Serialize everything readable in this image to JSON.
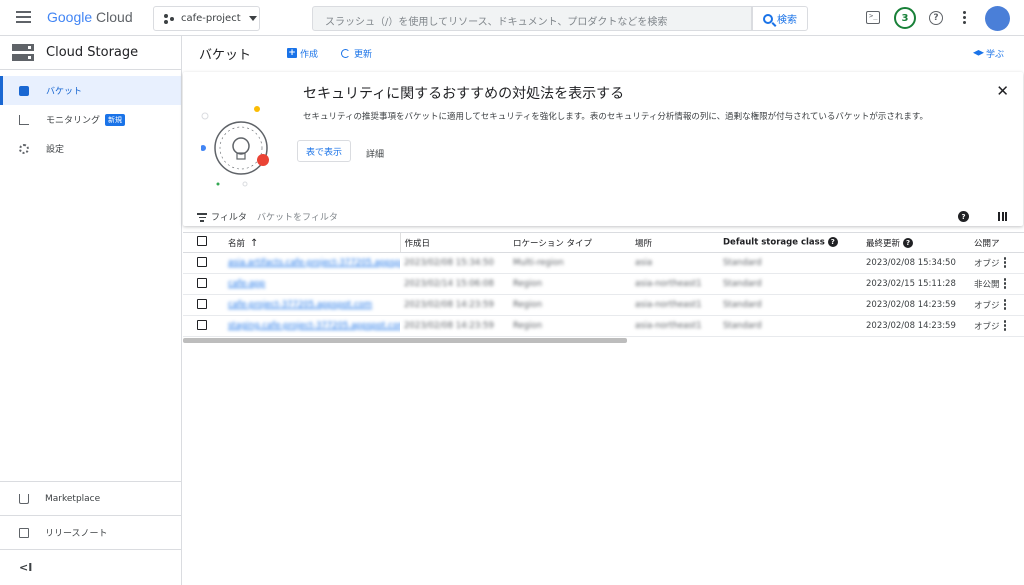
{
  "topbar": {
    "logo_google": "Google",
    "logo_cloud": "Cloud",
    "project": "cafe-project",
    "search_placeholder": "スラッシュ（/）を使用してリソース、ドキュメント、プロダクトなどを検索",
    "search_button": "検索",
    "terminal_glyph": ">_",
    "notification_count": "3",
    "help_glyph": "?"
  },
  "sidebar": {
    "title": "Cloud Storage",
    "items": [
      {
        "label": "バケット"
      },
      {
        "label": "モニタリング",
        "badge": "新規"
      },
      {
        "label": "設定"
      }
    ],
    "bottom": [
      {
        "label": "Marketplace"
      },
      {
        "label": "リリースノート"
      }
    ],
    "collapse_glyph": "<I"
  },
  "header": {
    "title": "バケット",
    "create": "作成",
    "refresh": "更新",
    "learn": "学ぶ"
  },
  "banner": {
    "title": "セキュリティに関するおすすめの対処法を表示する",
    "description": "セキュリティの推奨事項をバケットに適用してセキュリティを強化します。表のセキュリティ分析情報の列に、過剰な権限が付与されているバケットが示されます。",
    "button": "表で表示",
    "link": "詳細",
    "close": "✕"
  },
  "filter": {
    "label": "フィルタ",
    "placeholder": "バケットをフィルタ",
    "help_glyph": "?"
  },
  "table": {
    "columns": [
      "名前",
      "作成日",
      "ロケーション タイプ",
      "場所",
      "Default storage class",
      "最終更新",
      "公開ア"
    ],
    "sort_glyph": "↑",
    "rows": [
      {
        "name": "asia.artifacts.cafe-project-377205.appspot.com",
        "created": "2023/02/08 15:34:50",
        "location_type": "Multi-region",
        "location": "asia",
        "storage_class": "Standard",
        "updated": "2023/02/08 15:34:50",
        "access": "オブジ"
      },
      {
        "name": "cafe-app",
        "created": "2023/02/14 15:06:08",
        "location_type": "Region",
        "location": "asia-northeast1",
        "storage_class": "Standard",
        "updated": "2023/02/15 15:11:28",
        "access": "非公開"
      },
      {
        "name": "cafe-project-377205.appspot.com",
        "created": "2023/02/08 14:23:59",
        "location_type": "Region",
        "location": "asia-northeast1",
        "storage_class": "Standard",
        "updated": "2023/02/08 14:23:59",
        "access": "オブジ"
      },
      {
        "name": "staging.cafe-project-377205.appspot.com",
        "created": "2023/02/08 14:23:59",
        "location_type": "Region",
        "location": "asia-northeast1",
        "storage_class": "Standard",
        "updated": "2023/02/08 14:23:59",
        "access": "オブジ"
      }
    ]
  },
  "colors": {
    "accent": "#1a73e8",
    "active_nav_bg": "#e8f0fe",
    "notification_green": "#188038"
  }
}
